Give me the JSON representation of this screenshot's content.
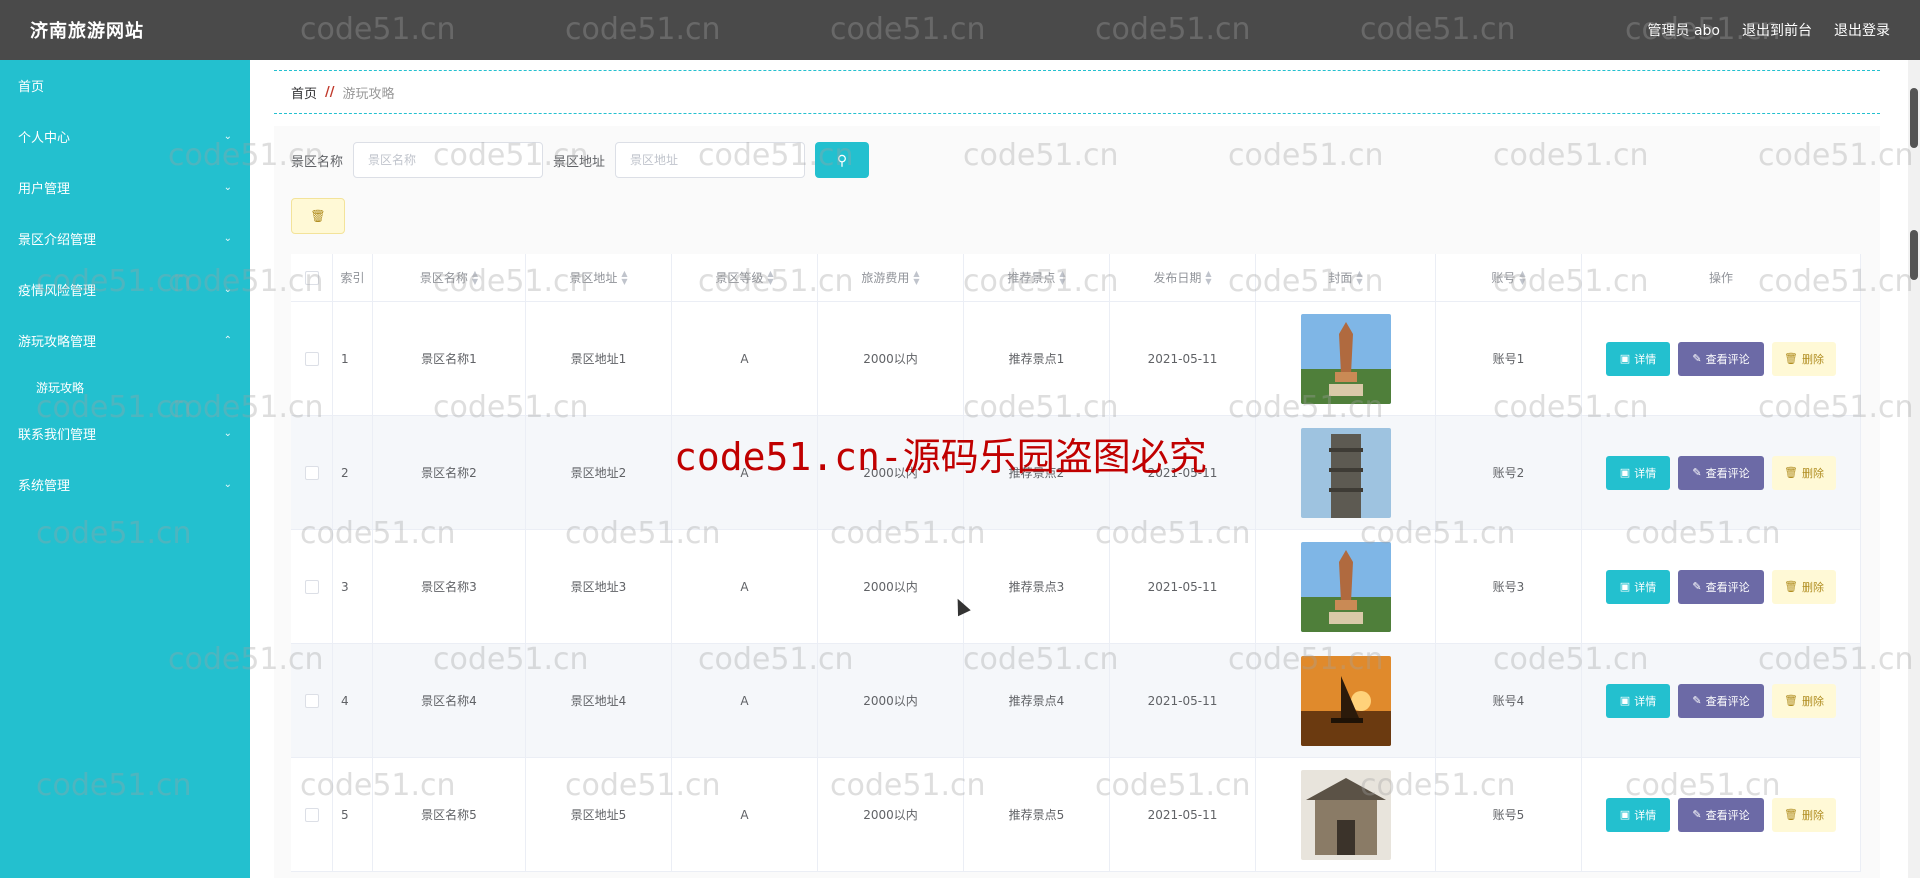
{
  "app": {
    "title": "济南旅游网站",
    "user_label": "管理员 abo",
    "to_front": "退出到前台",
    "logout": "退出登录"
  },
  "sidebar": {
    "items": [
      {
        "label": "首页",
        "expandable": false
      },
      {
        "label": "个人中心",
        "expandable": true
      },
      {
        "label": "用户管理",
        "expandable": true
      },
      {
        "label": "景区介绍管理",
        "expandable": true
      },
      {
        "label": "疫情风险管理",
        "expandable": true
      },
      {
        "label": "游玩攻略管理",
        "expandable": true,
        "expanded": true
      },
      {
        "label": "联系我们管理",
        "expandable": true
      },
      {
        "label": "系统管理",
        "expandable": true
      }
    ],
    "sub_items": [
      "游玩攻略"
    ]
  },
  "breadcrumb": {
    "home": "首页",
    "separator": "//",
    "current": "游玩攻略"
  },
  "search": {
    "name_label": "景区名称",
    "name_placeholder": "景区名称",
    "address_label": "景区地址",
    "address_placeholder": "景区地址",
    "search_icon": "search-icon"
  },
  "toolbar": {
    "batch_delete_icon": "trash-icon"
  },
  "table": {
    "headers": [
      "",
      "索引",
      "景区名称",
      "景区地址",
      "景区等级",
      "旅游费用",
      "推荐景点",
      "发布日期",
      "封面",
      "账号",
      "操作"
    ],
    "rows": [
      {
        "index": "1",
        "name": "景区名称1",
        "address": "景区地址1",
        "level": "A",
        "cost": "2000以内",
        "spot": "推荐景点1",
        "date": "2021-05-11",
        "cover": "pagoda",
        "account": "账号1"
      },
      {
        "index": "2",
        "name": "景区名称2",
        "address": "景区地址2",
        "level": "A",
        "cost": "2000以内",
        "spot": "推荐景点2",
        "date": "2021-05-11",
        "cover": "stone-tower",
        "account": "账号2"
      },
      {
        "index": "3",
        "name": "景区名称3",
        "address": "景区地址3",
        "level": "A",
        "cost": "2000以内",
        "spot": "推荐景点3",
        "date": "2021-05-11",
        "cover": "pagoda",
        "account": "账号3"
      },
      {
        "index": "4",
        "name": "景区名称4",
        "address": "景区地址4",
        "level": "A",
        "cost": "2000以内",
        "spot": "推荐景点4",
        "date": "2021-05-11",
        "cover": "sunset-boat",
        "account": "账号4"
      },
      {
        "index": "5",
        "name": "景区名称5",
        "address": "景区地址5",
        "level": "A",
        "cost": "2000以内",
        "spot": "推荐景点5",
        "date": "2021-05-11",
        "cover": "temple-gate",
        "account": "账号5"
      }
    ],
    "actions": {
      "detail": "详情",
      "review": "查看评论",
      "delete": "删除"
    }
  },
  "watermark": {
    "text": "code51.cn",
    "main": "code51.cn-源码乐园盗图必究"
  },
  "colors": {
    "topbar": "#4a4a4a",
    "sidebar": "#23c0cf",
    "accent": "#23c0cf",
    "review": "#6c6aa6",
    "delete_bg": "#fff9d6"
  }
}
